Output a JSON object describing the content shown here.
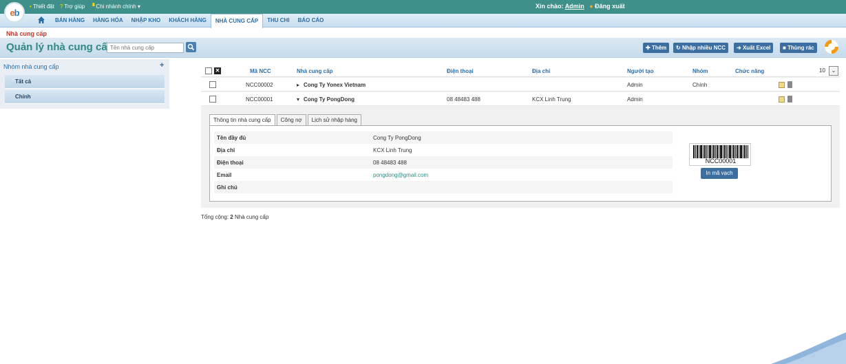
{
  "topbar": {
    "links": [
      "Thiết đặt",
      "Trợ giúp",
      "Chi nhánh chính"
    ],
    "greeting": "Xin chào:",
    "user": "Admin",
    "logout": "Đăng xuất"
  },
  "nav": {
    "items": [
      "BÁN HÀNG",
      "HÀNG HÓA",
      "NHẬP KHO",
      "KHÁCH HÀNG",
      "NHÀ CUNG CẤP",
      "THU CHI",
      "BÁO CÁO"
    ],
    "active_index": 4
  },
  "breadcrumb": "Nhà cung cấp",
  "page": {
    "title": "Quản lý nhà cung cấp",
    "search_placeholder": "Tên nhà cung cấp",
    "buttons": [
      "Thêm",
      "Nhập nhiều NCC",
      "Xuất Excel",
      "Thùng rác"
    ]
  },
  "sidebar": {
    "title": "Nhóm nhà cung cấp",
    "items": [
      "Tất cả",
      "Chính"
    ]
  },
  "table": {
    "headers": [
      "Mã NCC",
      "Nhà cung cấp",
      "Điện thoại",
      "Địa chỉ",
      "Người tạo",
      "Nhóm",
      "Chức năng"
    ],
    "page_size": "10",
    "rows": [
      {
        "code": "NCC00002",
        "name": "Cong Ty Yonex Vietnam",
        "phone": "",
        "address": "",
        "creator": "Admin",
        "group": "Chính"
      },
      {
        "code": "NCC00001",
        "name": "Cong Ty PongDong",
        "phone": "08 48483 488",
        "address": "KCX Linh Trung",
        "creator": "Admin",
        "group": ""
      }
    ]
  },
  "detail": {
    "tabs": [
      "Thông tin nhà cung cấp",
      "Công nợ",
      "Lịch sử nhập hàng"
    ],
    "fields": [
      {
        "label": "Tên đầy đủ",
        "value": "Cong Ty PongDong"
      },
      {
        "label": "Địa chỉ",
        "value": "KCX Linh Trung"
      },
      {
        "label": "Điện thoại",
        "value": "08 48483 488"
      },
      {
        "label": "Email",
        "value": "pongdong@gmail.com"
      },
      {
        "label": "Ghi chú",
        "value": ""
      }
    ],
    "barcode": "NCC00001",
    "print_label": "In mã vạch"
  },
  "footer": {
    "total_prefix": "Tổng cộng:",
    "total_count": "2",
    "total_suffix": "Nhà cung cấp"
  }
}
